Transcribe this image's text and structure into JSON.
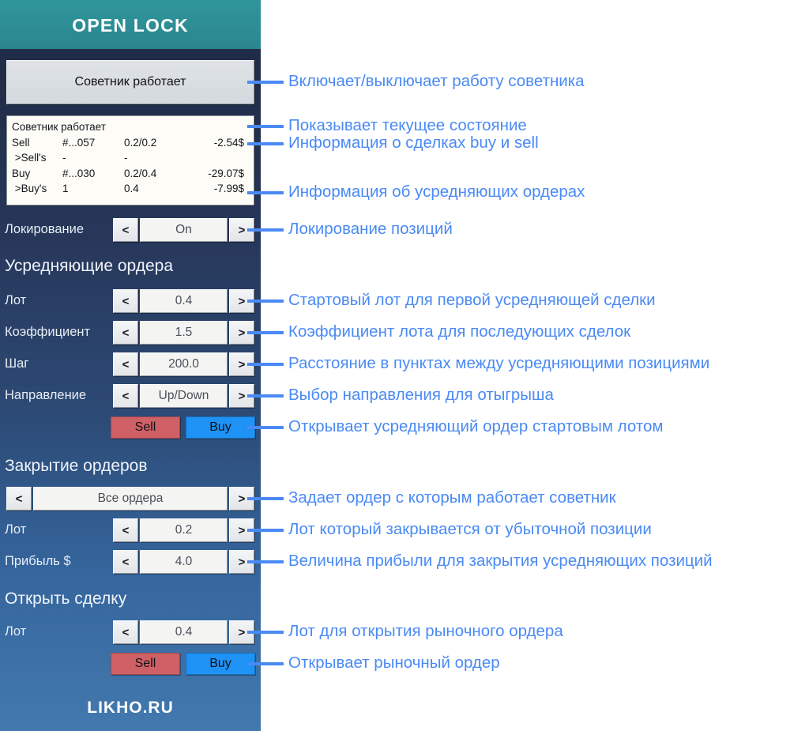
{
  "panel": {
    "title": "OPEN LOCK",
    "footer": "LIKHO.RU",
    "status_button_label": "Советник работает",
    "info": {
      "status_line": "Советник работает",
      "rows": [
        {
          "c0": "Sell",
          "c1": "#...057",
          "c2": "0.2/0.2",
          "c3": "-2.54$"
        },
        {
          "c0": " >Sell's",
          "c1": "-",
          "c2": "-",
          "c3": ""
        },
        {
          "c0": "Buy",
          "c1": "#...030",
          "c2": "0.2/0.4",
          "c3": "-29.07$"
        },
        {
          "c0": " >Buy's",
          "c1": "1",
          "c2": "0.4",
          "c3": "-7.99$"
        }
      ]
    },
    "locking": {
      "label": "Локирование",
      "value": "On"
    },
    "section_averaging": {
      "heading": "Усредняющие ордера",
      "lot": {
        "label": "Лот",
        "value": "0.4"
      },
      "coef": {
        "label": "Коэффициент",
        "value": "1.5"
      },
      "step": {
        "label": "Шаг",
        "value": "200.0"
      },
      "dir": {
        "label": "Направление",
        "value": "Up/Down"
      },
      "sell_label": "Sell",
      "buy_label": "Buy"
    },
    "section_closing": {
      "heading": "Закрытие ордеров",
      "scope": {
        "value": "Все ордера"
      },
      "lot": {
        "label": "Лот",
        "value": "0.2"
      },
      "profit": {
        "label": "Прибыль $",
        "value": "4.0"
      }
    },
    "section_open": {
      "heading": "Открыть сделку",
      "lot": {
        "label": "Лот",
        "value": "0.4"
      },
      "sell_label": "Sell",
      "buy_label": "Buy"
    },
    "arrows": {
      "prev": "<",
      "next": ">"
    },
    "colors": {
      "title_bar": "#2e8b94",
      "sell": "#cf6065",
      "buy": "#1e93f5",
      "annotation": "#4a8af4"
    }
  },
  "annotations": [
    {
      "text": "Включает/выключает работу советника"
    },
    {
      "text": "Показывает текущее состояние"
    },
    {
      "text": "Информация о сделках buy и sell"
    },
    {
      "text": "Информация об усредняющих ордерах"
    },
    {
      "text": "Локирование позиций"
    },
    {
      "text": "Стартовый лот для первой усредняющей сделки"
    },
    {
      "text": "Коэффициент лота для последующих сделок"
    },
    {
      "text": "Расстояние в пунктах между усредняющими позициями"
    },
    {
      "text": "Выбор направления для отыгрыша"
    },
    {
      "text": "Открывает усредняющий ордер стартовым лотом"
    },
    {
      "text": "Задает ордер с которым работает советник"
    },
    {
      "text": "Лот который закрывается от убыточной позиции"
    },
    {
      "text": "Величина прибыли для закрытия усредняющих позиций"
    },
    {
      "text": "Лот для открытия рыночного ордера"
    },
    {
      "text": "Открывает рыночный ордер"
    }
  ]
}
